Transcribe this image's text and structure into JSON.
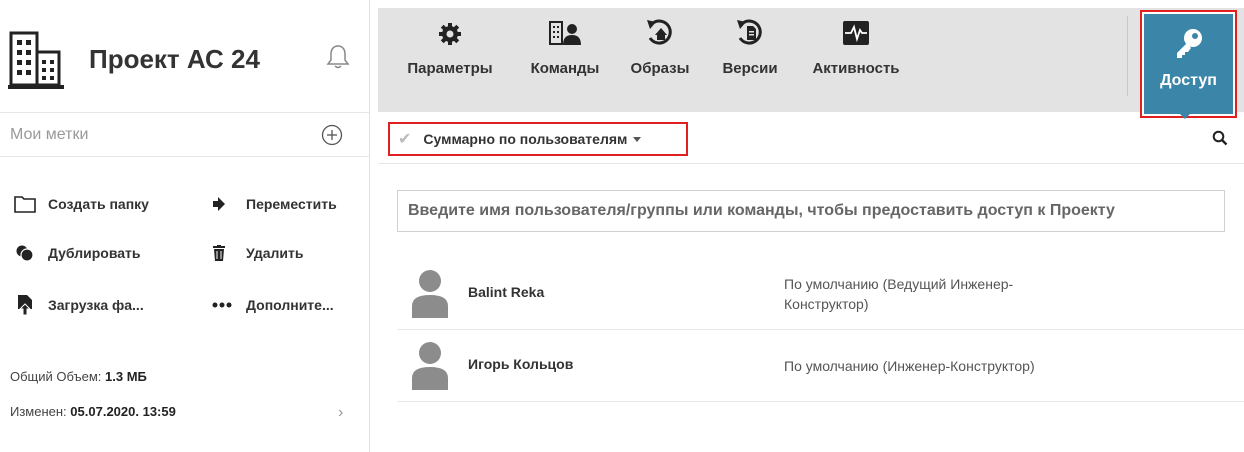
{
  "project": {
    "title": "Проект АС 24",
    "icon": "building-icon"
  },
  "tags": {
    "label": "Мои метки"
  },
  "actions": {
    "create_folder": "Создать папку",
    "move": "Переместить",
    "duplicate": "Дублировать",
    "delete": "Удалить",
    "upload": "Загрузка фа...",
    "more": "Дополните..."
  },
  "meta": {
    "volume_label": "Общий Объем: ",
    "volume_value": "1.3 МБ",
    "modified_label": "Изменен: ",
    "modified_value": "05.07.2020. 13:59"
  },
  "toolbar": {
    "settings": "Параметры",
    "teams": "Команды",
    "images": "Образы",
    "versions": "Версии",
    "activity": "Активность",
    "access": "Доступ"
  },
  "filter": {
    "label": "Суммарно по пользователям"
  },
  "share": {
    "placeholder": "Введите имя пользователя/группы или команды, чтобы предоставить доступ к Проекту"
  },
  "users": [
    {
      "name": "Balint Reka",
      "role": "По умолчанию  (Ведущий Инженер-Конструктор)"
    },
    {
      "name": "Игорь Кольцов",
      "role": "По умолчанию  (Инженер-Конструктор)"
    }
  ],
  "colors": {
    "accent": "#3b86a8",
    "highlight": "#e02020",
    "toolbar_bg": "#e3e3e3"
  }
}
